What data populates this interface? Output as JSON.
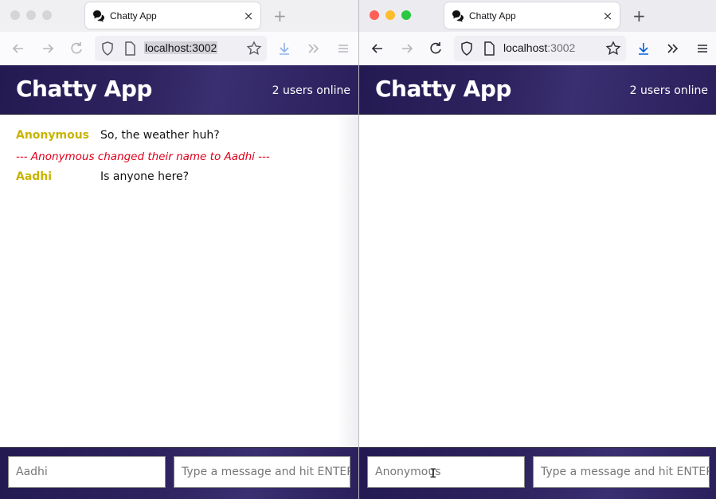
{
  "windows": [
    {
      "id": "left",
      "tab": {
        "title": "Chatty App",
        "close": "×"
      },
      "new_tab": "+",
      "url": {
        "host": "localhost",
        "port": ":3002"
      },
      "app": {
        "title": "Chatty App",
        "users_online": "2 users online"
      },
      "messages": [
        {
          "type": "message",
          "username": "Anonymous",
          "content": "So, the weather huh?"
        },
        {
          "type": "notification",
          "content": "--- Anonymous changed their name to Aadhi ---"
        },
        {
          "type": "message",
          "username": "Aadhi",
          "content": "Is anyone here?"
        }
      ],
      "chatbar": {
        "username_value": "Aadhi",
        "message_placeholder": "Type a message and hit ENTER"
      }
    },
    {
      "id": "right",
      "tab": {
        "title": "Chatty App",
        "close": "×"
      },
      "new_tab": "+",
      "url": {
        "host": "localhost",
        "port": ":3002"
      },
      "app": {
        "title": "Chatty App",
        "users_online": "2 users online"
      },
      "messages": [],
      "chatbar": {
        "username_value": "Anonymous",
        "message_placeholder": "Type a message and hit ENTER"
      }
    }
  ],
  "colors": {
    "header_bg": "#2f235f",
    "username": "#c8b400",
    "notification": "#e0001b",
    "download_active": "#0060df"
  }
}
